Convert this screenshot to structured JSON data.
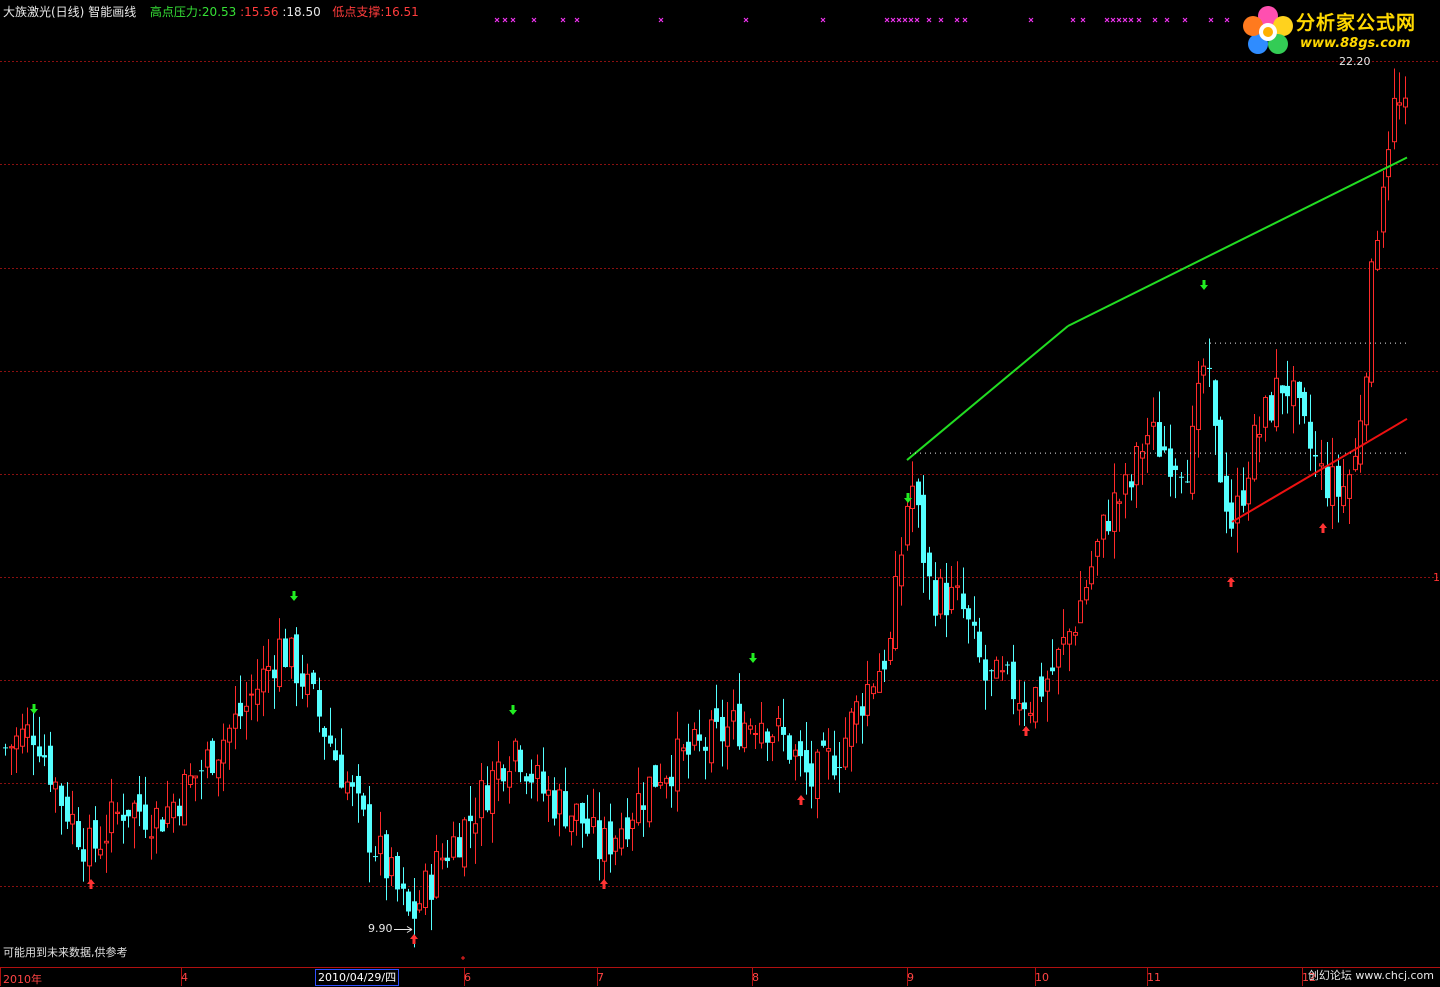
{
  "header": {
    "stock_title": "大族激光(日线)",
    "indicator_name": "智能画线",
    "resistance_label": "高点压力:",
    "resistance_values": [
      "20.53",
      ":15.56",
      ":18.50"
    ],
    "support_label": "低点支撑:",
    "support_value": "16.51"
  },
  "logo": {
    "title": "分析家公式网",
    "url": "www.88gs.com"
  },
  "chart_data": {
    "type": "candlestick",
    "period": "daily",
    "price_range": [
      9.5,
      23.2
    ],
    "high_label": "22.20",
    "low_label": "9.90",
    "x_axis_labels": [
      "2010年",
      "4",
      "6",
      "7",
      "8",
      "9",
      "10",
      "11",
      "12"
    ],
    "cursor_date": "2010/04/29/四",
    "resistance_line": {
      "color": "#22dd22",
      "from_price": 16.8,
      "to_price": 21.2
    },
    "support_line": {
      "color": "#ee1111",
      "from_price": 15.9,
      "to_price": 17.4
    },
    "horizontal_refs": [
      18.5,
      16.9
    ],
    "gridlines": [
      22.6,
      21.1,
      19.6,
      18.1,
      16.6,
      15.1,
      13.6,
      12.1,
      10.6
    ],
    "colors": {
      "up": "#ff2a2a",
      "down": "#55ffff",
      "buy_arrow": "#ff3333",
      "sell_arrow": "#22ee22",
      "marks": "#ee33ee",
      "grid": "#8a1010"
    }
  },
  "right_axis_marker": "1",
  "note": "可能用到未来数据,供参考",
  "footer": "创幻论坛 www.chcj.com"
}
